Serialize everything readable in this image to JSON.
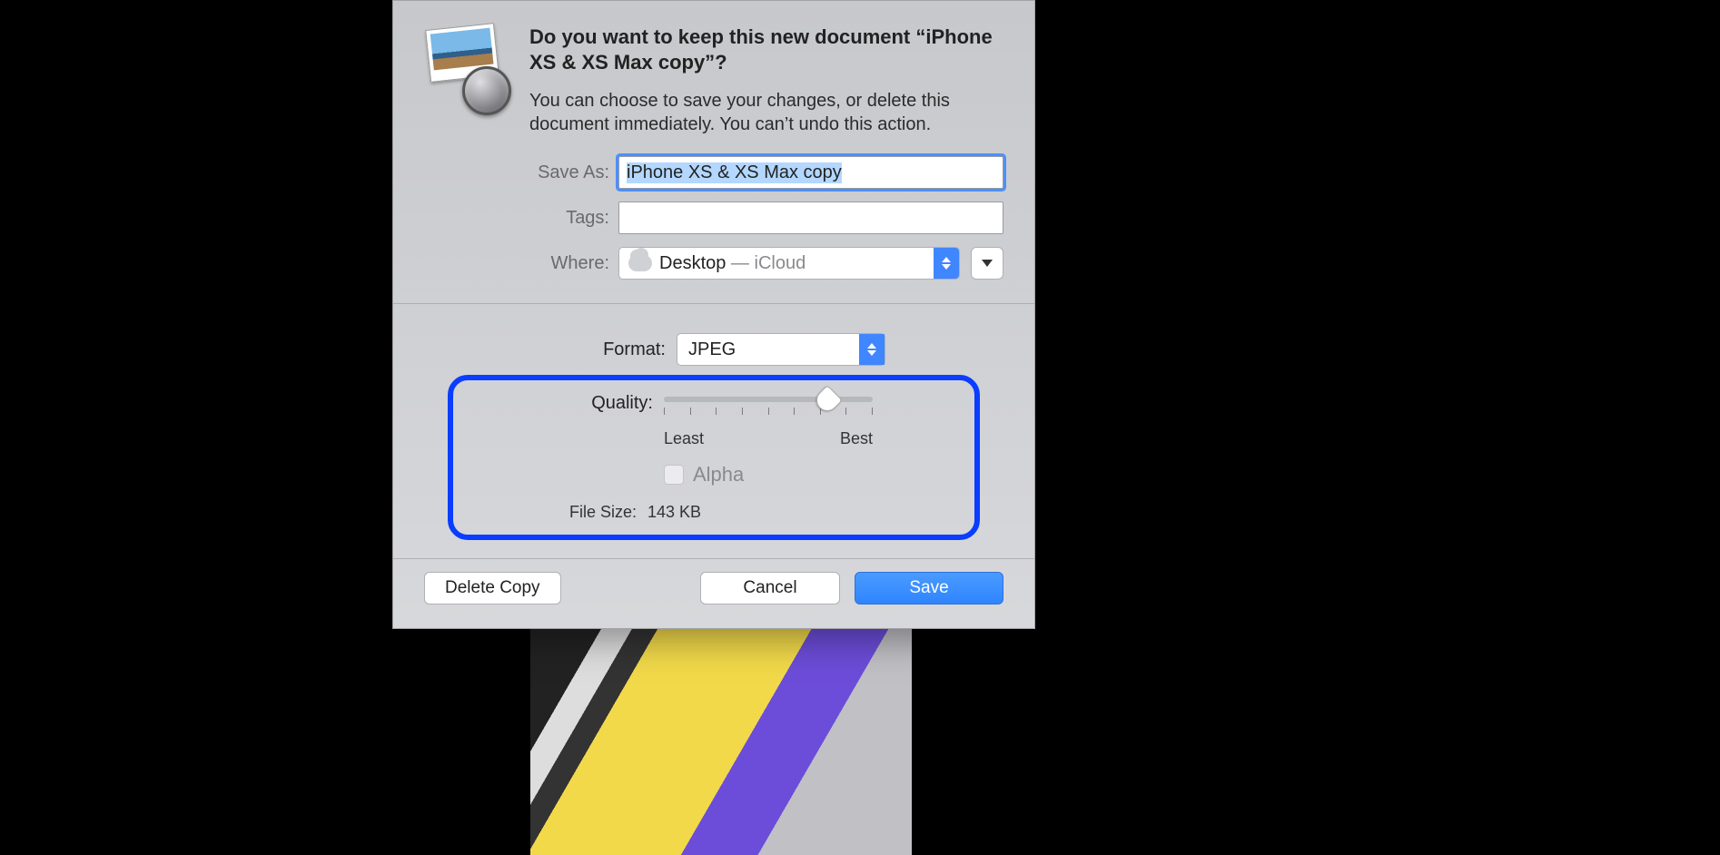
{
  "dialog": {
    "title": "Do you want to keep this new document “iPhone XS & XS Max copy”?",
    "body": "You can choose to save your changes, or delete this document immediately. You can’t undo this action.",
    "save_as_label": "Save As:",
    "save_as_value": "iPhone XS & XS Max copy",
    "tags_label": "Tags:",
    "tags_value": "",
    "where_label": "Where:",
    "where_location": "Desktop",
    "where_separator": " — ",
    "where_cloud": "iCloud",
    "format_label": "Format:",
    "format_value": "JPEG",
    "quality_label": "Quality:",
    "quality_least": "Least",
    "quality_best": "Best",
    "alpha_label": "Alpha",
    "filesize_label": "File Size:",
    "filesize_value": "143 KB",
    "delete_label": "Delete Copy",
    "cancel_label": "Cancel",
    "save_label": "Save"
  }
}
